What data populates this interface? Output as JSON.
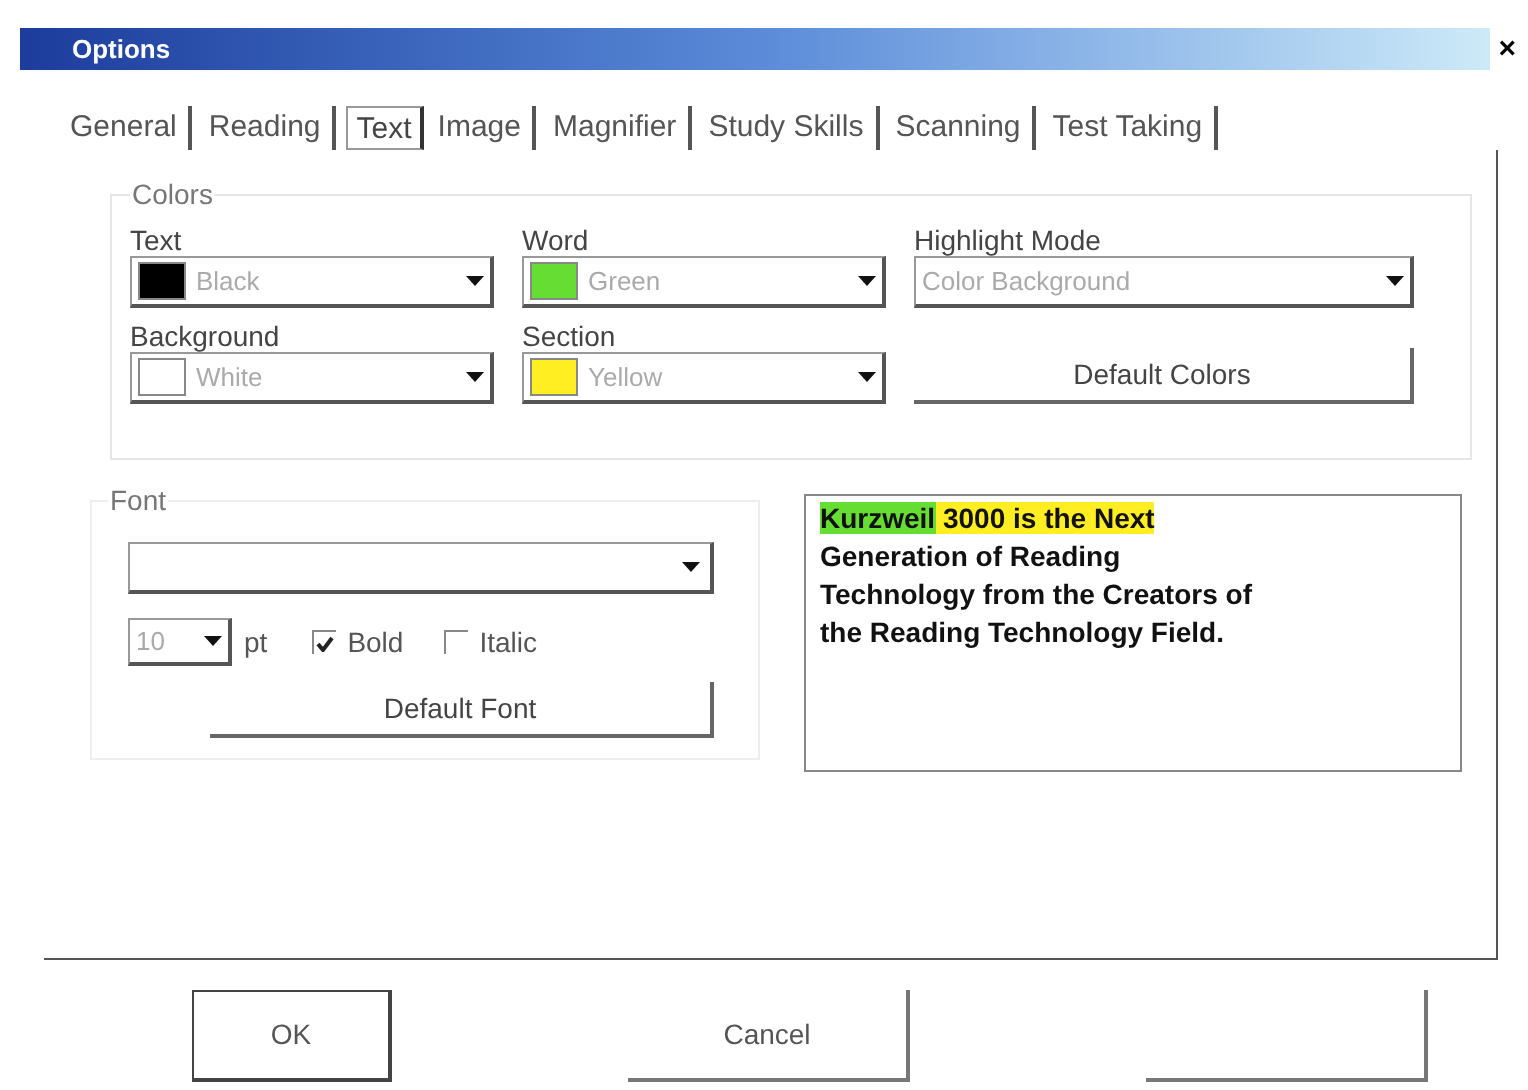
{
  "window": {
    "title": "Options",
    "close": "×"
  },
  "tabs": [
    {
      "label": "General",
      "selected": false
    },
    {
      "label": "Reading",
      "selected": false
    },
    {
      "label": "Text",
      "selected": true
    },
    {
      "label": "Image",
      "selected": false
    },
    {
      "label": "Magnifier",
      "selected": false
    },
    {
      "label": "Study Skills",
      "selected": false
    },
    {
      "label": "Scanning",
      "selected": false
    },
    {
      "label": "Test Taking",
      "selected": false
    }
  ],
  "colors": {
    "title": "Colors",
    "fields": [
      {
        "label": "Text",
        "value": "Black",
        "color": "#000000"
      },
      {
        "label": "Word",
        "value": "Green",
        "color": "#66dd33"
      },
      {
        "label": "Highlight Mode",
        "value": "Color Background"
      },
      {
        "label": "Background",
        "value": "White",
        "color": "#ffffff"
      },
      {
        "label": "Section",
        "value": "Yellow",
        "color": "#ffee22"
      }
    ],
    "default_button": "Default Colors"
  },
  "font": {
    "title": "Font",
    "size": "10",
    "unit": "pt",
    "options": [
      {
        "label": "Bold",
        "checked": true
      },
      {
        "label": "Italic",
        "checked": false
      }
    ],
    "default_button": "Default Font"
  },
  "preview": {
    "lines": [
      [
        {
          "kind": "word",
          "text": "Kurzweil"
        },
        {
          "kind": "section",
          "text": " 3000 is the Next"
        }
      ],
      [
        {
          "kind": "plain",
          "text": "Generation of Reading"
        }
      ],
      [
        {
          "kind": "plain",
          "text": "Technology from the Creators of"
        }
      ],
      [
        {
          "kind": "plain",
          "text": "the Reading Technology Field."
        }
      ]
    ]
  },
  "buttons": [
    {
      "label": "OK",
      "default": true
    },
    {
      "label": "Cancel",
      "default": false
    },
    {
      "default": false
    }
  ]
}
